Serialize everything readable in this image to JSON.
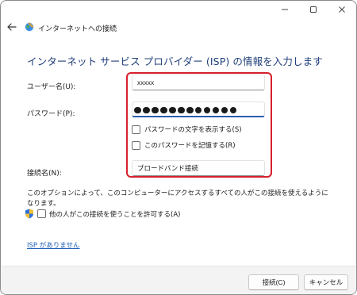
{
  "window": {
    "title": "インターネットへの接続"
  },
  "heading": "インターネット サービス プロバイダー (ISP) の情報を入力します",
  "form": {
    "username_label": "ユーザー名(U):",
    "username_value": "xxxxx",
    "password_label": "パスワード(P):",
    "password_length": 12,
    "show_password_label": "パスワードの文字を表示する(S)",
    "show_password_checked": false,
    "remember_password_label": "このパスワードを記憶する(R)",
    "remember_password_checked": false,
    "connection_name_label": "接続名(N):",
    "connection_name_value": "ブロードバンド接続"
  },
  "notice": "このオプションによって、このコンピューターにアクセスするすべての人がこの接続を使えるようになります。",
  "allow_others_label": "他の人がこの接続を使うことを許可する(A)",
  "allow_others_checked": false,
  "no_isp_link": "ISP がありません",
  "buttons": {
    "connect": "接続(C)",
    "cancel": "キャンセル"
  },
  "colors": {
    "heading": "#1f3f7a",
    "highlight": "#d61f2c",
    "link": "#1f5fb8",
    "focus": "#2b5fad"
  }
}
